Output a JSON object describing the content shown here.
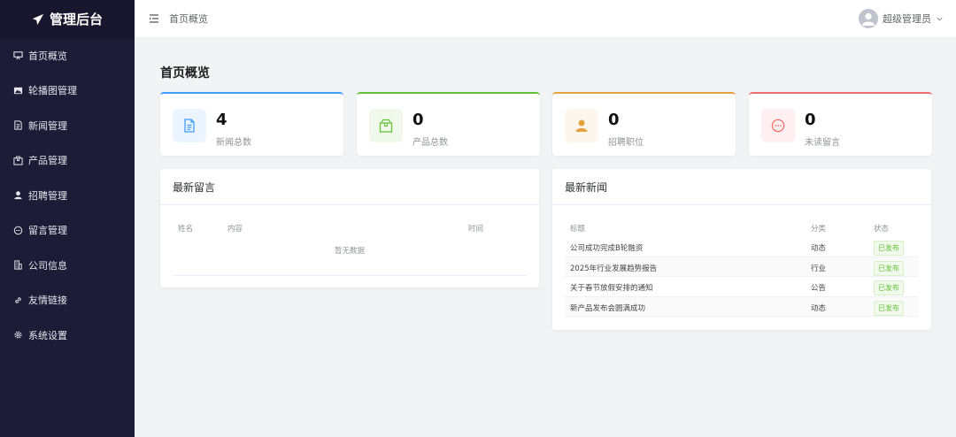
{
  "brand": {
    "title": "管理后台",
    "icon": "paper-plane-icon"
  },
  "sidebar": {
    "items": [
      {
        "label": "首页概览",
        "icon": "monitor-icon"
      },
      {
        "label": "轮播图管理",
        "icon": "image-icon"
      },
      {
        "label": "新闻管理",
        "icon": "document-icon"
      },
      {
        "label": "产品管理",
        "icon": "box-icon"
      },
      {
        "label": "招聘管理",
        "icon": "user-icon"
      },
      {
        "label": "留言管理",
        "icon": "chat-icon"
      },
      {
        "label": "公司信息",
        "icon": "building-icon"
      },
      {
        "label": "友情链接",
        "icon": "link-icon"
      },
      {
        "label": "系统设置",
        "icon": "gear-icon"
      }
    ]
  },
  "header": {
    "breadcrumb": "首页概览",
    "user_name": "超级管理员"
  },
  "main": {
    "title": "首页概览",
    "stats": [
      {
        "value": "4",
        "label": "新闻总数",
        "color": "#409eff",
        "bg": "#ecf5ff",
        "icon": "document-icon"
      },
      {
        "value": "0",
        "label": "产品总数",
        "color": "#67c23a",
        "bg": "#f0f9eb",
        "icon": "box-icon"
      },
      {
        "value": "0",
        "label": "招聘职位",
        "color": "#e6a23c",
        "bg": "#fdf6ec",
        "icon": "user-icon"
      },
      {
        "value": "0",
        "label": "未读留言",
        "color": "#f56c6c",
        "bg": "#fef0f0",
        "icon": "chat-icon"
      }
    ],
    "messages": {
      "title": "最新留言",
      "columns": [
        "姓名",
        "内容",
        "时间"
      ],
      "empty_text": "暂无数据"
    },
    "news": {
      "title": "最新新闻",
      "columns": [
        "标题",
        "分类",
        "状态"
      ],
      "rows": [
        {
          "title": "公司成功完成B轮融资",
          "category": "动态",
          "status": "已发布"
        },
        {
          "title": "2025年行业发展趋势报告",
          "category": "行业",
          "status": "已发布"
        },
        {
          "title": "关于春节放假安排的通知",
          "category": "公告",
          "status": "已发布"
        },
        {
          "title": "新产品发布会圆满成功",
          "category": "动态",
          "status": "已发布"
        }
      ]
    }
  }
}
